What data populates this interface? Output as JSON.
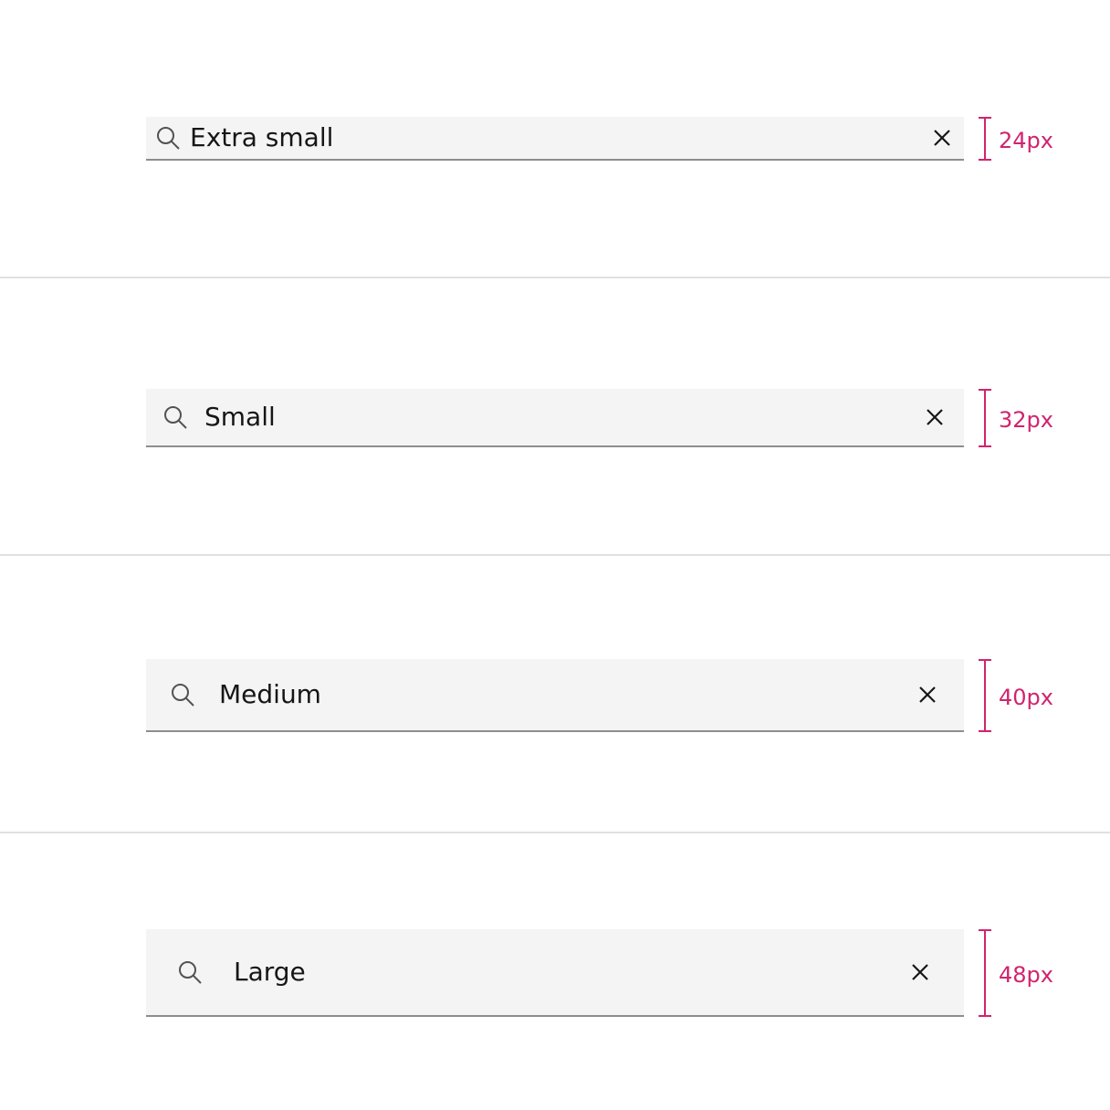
{
  "colors": {
    "field_background": "#f4f4f4",
    "field_border": "#8d8d8d",
    "text": "#161616",
    "icon": "#525252",
    "measure": "#d0246e",
    "divider": "#e0e0e0"
  },
  "rows": [
    {
      "size": "extra-small",
      "text": "Extra small",
      "measurement": "24px",
      "search_icon": "search-icon",
      "clear_icon": "close-icon"
    },
    {
      "size": "small",
      "text": "Small",
      "measurement": "32px",
      "search_icon": "search-icon",
      "clear_icon": "close-icon"
    },
    {
      "size": "medium",
      "text": "Medium",
      "measurement": "40px",
      "search_icon": "search-icon",
      "clear_icon": "close-icon"
    },
    {
      "size": "large",
      "text": "Large",
      "measurement": "48px",
      "search_icon": "search-icon",
      "clear_icon": "close-icon"
    }
  ]
}
